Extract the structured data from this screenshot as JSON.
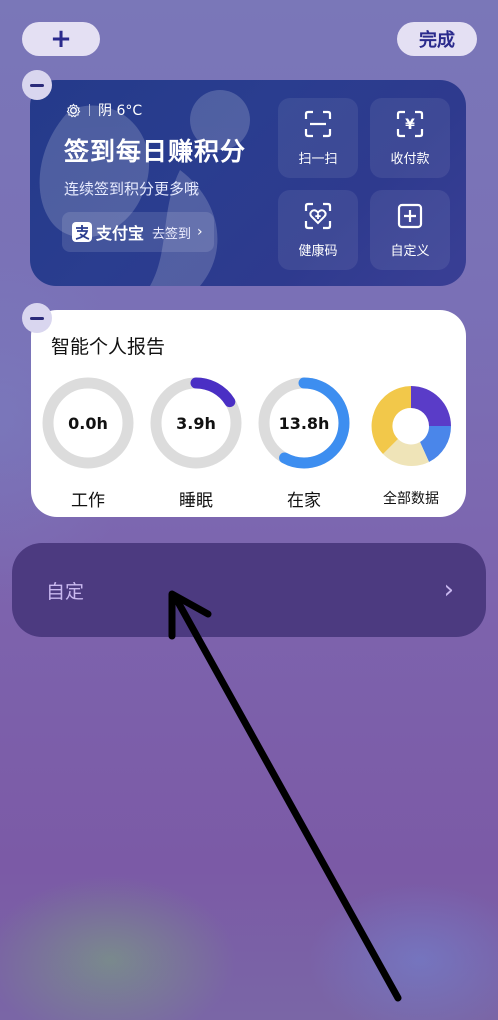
{
  "top_bar": {
    "add_label": "+",
    "done_label": "完成"
  },
  "alipay_widget": {
    "weather": "阴 6°C",
    "title": "签到每日赚积分",
    "subtitle": "连续签到积分更多哦",
    "brand": "支付宝",
    "signin_label": "去签到",
    "signin_chevron": "›",
    "tiles": [
      {
        "label": "扫一扫",
        "icon": "scan-icon"
      },
      {
        "label": "收付款",
        "icon": "payment-icon"
      },
      {
        "label": "健康码",
        "icon": "health-code-icon"
      },
      {
        "label": "自定义",
        "icon": "plus-square-icon"
      }
    ]
  },
  "report_widget": {
    "title": "智能个人报告",
    "items": [
      {
        "label": "工作",
        "value": "0.0h",
        "progress": 0.0
      },
      {
        "label": "睡眠",
        "value": "3.9h",
        "progress": 0.16
      },
      {
        "label": "在家",
        "value": "13.8h",
        "progress": 0.58
      }
    ],
    "all_data_label": "全部数据",
    "colors": {
      "track": "#dcdcdc",
      "sleep": "#4a2fc4",
      "home": "#3d8ef0"
    }
  },
  "custom_row": {
    "label": "自定",
    "chevron": "›"
  }
}
